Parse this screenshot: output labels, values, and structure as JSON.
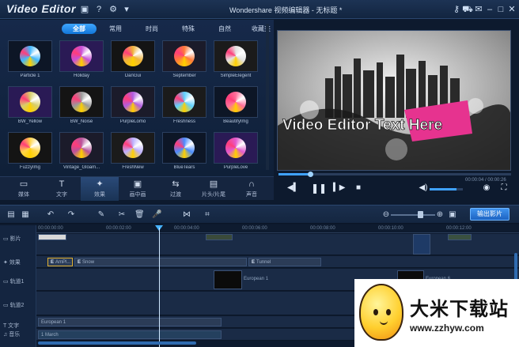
{
  "app": {
    "title": "Video Editor",
    "window_title": "Wondershare 视频编辑器 - 无标题 *"
  },
  "effects": {
    "categories": [
      "全部",
      "常用",
      "时尚",
      "特殊",
      "自然",
      "收藏夹"
    ],
    "active_category": "全部",
    "items": [
      {
        "label": "Particle 1",
        "color": "#3fb7ff"
      },
      {
        "label": "Holiday",
        "color": "#c84fd8"
      },
      {
        "label": "DanGui",
        "color": "#f0b43c"
      },
      {
        "label": "September",
        "color": "#ff7a3a"
      },
      {
        "label": "SimpleElegent",
        "color": "#e3e3e3"
      },
      {
        "label": "BW_Yellow",
        "color": "#d8cf6a"
      },
      {
        "label": "BW_Noise",
        "color": "#9a9a9a"
      },
      {
        "label": "PurpleLomo",
        "color": "#b15ce0"
      },
      {
        "label": "Freshness",
        "color": "#5fd1ff"
      },
      {
        "label": "BeautifyImg",
        "color": "#ff6f9a"
      },
      {
        "label": "FuzzyImg",
        "color": "#ffd54a"
      },
      {
        "label": "Vintage_Gloam...",
        "color": "#b8529a"
      },
      {
        "label": "FreshNew",
        "color": "#bcb0ff"
      },
      {
        "label": "BlueTears",
        "color": "#4a8bff"
      },
      {
        "label": "PurpleLove",
        "color": "#e25ad0"
      }
    ]
  },
  "modes": [
    {
      "label": "媒体",
      "icon": "media-icon"
    },
    {
      "label": "文字",
      "icon": "text-icon"
    },
    {
      "label": "效果",
      "icon": "effects-wand-icon"
    },
    {
      "label": "画中画",
      "icon": "pip-icon"
    },
    {
      "label": "过渡",
      "icon": "transition-icon"
    },
    {
      "label": "片头/片尾",
      "icon": "intro-icon"
    },
    {
      "label": "声音",
      "icon": "headphones-icon"
    }
  ],
  "active_mode": "效果",
  "preview": {
    "overlay_text": "Video Editor Text Here",
    "timecode": "00:00:04 / 00:00:26"
  },
  "playback": {
    "position_fraction": 0.14,
    "volume_fraction": 0.8
  },
  "toolbar": {
    "export_label": "输出影片"
  },
  "timeline": {
    "ticks": [
      "00:00:00:00",
      "00:00:02:00",
      "00:00:04:00",
      "00:00:06:00",
      "00:00:08:00",
      "00:00:10:00",
      "00:00:12:00"
    ],
    "tracks": [
      "影片",
      "效果",
      "轨道1",
      "轨道2",
      "文字",
      "音乐"
    ],
    "effect_clips": [
      "AmPl...",
      "Snow",
      "Tunnel"
    ],
    "track1_clips": [
      "European 1",
      "European 6"
    ],
    "text_clip": "European 1",
    "music_clip": "1 March"
  },
  "watermark": {
    "title": "大米下载站",
    "url": "www.zzhyw.com"
  }
}
